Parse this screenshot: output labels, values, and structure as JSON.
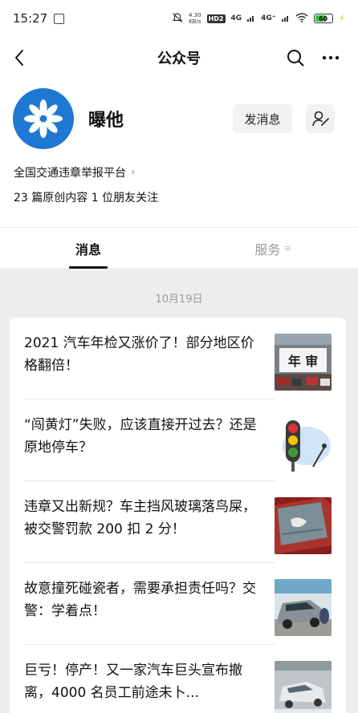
{
  "status_bar": {
    "time": "15:27",
    "net_speed_value": "4.30",
    "net_speed_unit": "KB/s",
    "hd_label": "HD",
    "hd_sub": "2",
    "net_1": "4G",
    "net_2": "4G⁺",
    "battery_level": "60",
    "battery_fraction": 0.6
  },
  "header": {
    "title": "公众号"
  },
  "profile": {
    "name": "曝他",
    "send_message_label": "发消息",
    "description": "全国交通违章举报平台",
    "stats": "23 篇原创内容  1 位朋友关注"
  },
  "tabs": {
    "messages": "消息",
    "services": "服务"
  },
  "date_label": "10月19日",
  "articles": [
    {
      "title": "2021 汽车年检又涨价了！部分地区价格翻倍！",
      "thumb_text": "年 审"
    },
    {
      "title": "“闯黄灯”失败，应该直接开过去？还是原地停车？",
      "thumb_text": ""
    },
    {
      "title": "违章又出新规？车主挡风玻璃落鸟屎，被交警罚款 200 扣 2 分！",
      "thumb_text": ""
    },
    {
      "title": "故意撞死碰瓷者，需要承担责任吗？交警：学着点！",
      "thumb_text": ""
    },
    {
      "title": "巨亏！停产！又一家汽车巨头宣布撤离，4000 名员工前途未卜...",
      "thumb_text": ""
    }
  ],
  "colors": {
    "avatar_bg": "#1f78d1",
    "page_bg": "#ededed",
    "battery_green": "#3ec63e"
  }
}
